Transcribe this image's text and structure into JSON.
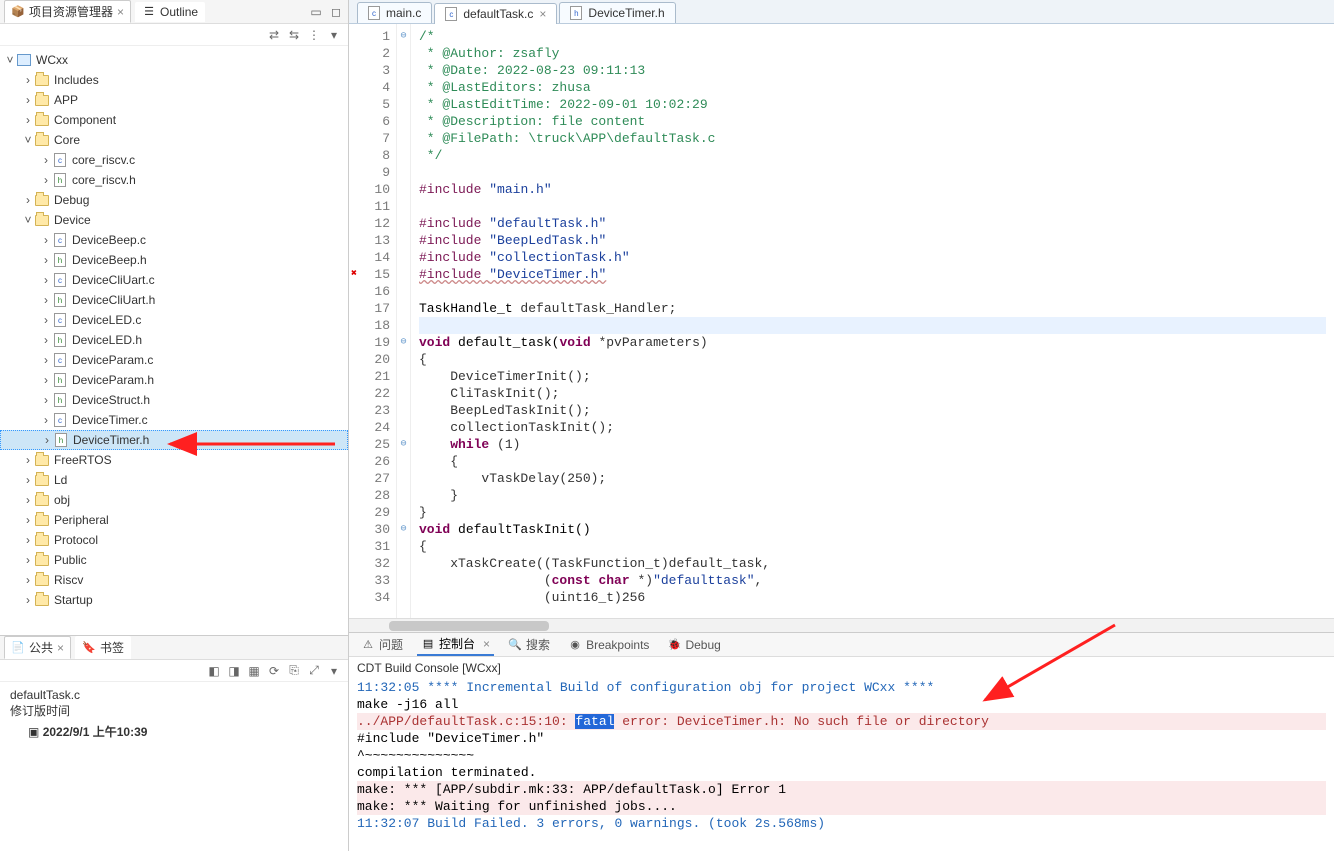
{
  "explorer": {
    "tab_label": "项目资源管理器",
    "outline_tab": "Outline",
    "project": "WCxx",
    "nodes": [
      {
        "depth": 1,
        "caret": ">",
        "icon": "folder",
        "label": "Includes"
      },
      {
        "depth": 1,
        "caret": ">",
        "icon": "folder",
        "label": "APP"
      },
      {
        "depth": 1,
        "caret": ">",
        "icon": "folder",
        "label": "Component"
      },
      {
        "depth": 1,
        "caret": "v",
        "icon": "folder",
        "label": "Core"
      },
      {
        "depth": 2,
        "caret": ">",
        "icon": "c",
        "label": "core_riscv.c"
      },
      {
        "depth": 2,
        "caret": ">",
        "icon": "h",
        "label": "core_riscv.h"
      },
      {
        "depth": 1,
        "caret": ">",
        "icon": "folder",
        "label": "Debug"
      },
      {
        "depth": 1,
        "caret": "v",
        "icon": "folder",
        "label": "Device"
      },
      {
        "depth": 2,
        "caret": ">",
        "icon": "c",
        "label": "DeviceBeep.c"
      },
      {
        "depth": 2,
        "caret": ">",
        "icon": "h",
        "label": "DeviceBeep.h"
      },
      {
        "depth": 2,
        "caret": ">",
        "icon": "c",
        "label": "DeviceCliUart.c"
      },
      {
        "depth": 2,
        "caret": ">",
        "icon": "h",
        "label": "DeviceCliUart.h"
      },
      {
        "depth": 2,
        "caret": ">",
        "icon": "c",
        "label": "DeviceLED.c"
      },
      {
        "depth": 2,
        "caret": ">",
        "icon": "h",
        "label": "DeviceLED.h"
      },
      {
        "depth": 2,
        "caret": ">",
        "icon": "c",
        "label": "DeviceParam.c"
      },
      {
        "depth": 2,
        "caret": ">",
        "icon": "h",
        "label": "DeviceParam.h"
      },
      {
        "depth": 2,
        "caret": ">",
        "icon": "h",
        "label": "DeviceStruct.h"
      },
      {
        "depth": 2,
        "caret": ">",
        "icon": "c",
        "label": "DeviceTimer.c"
      },
      {
        "depth": 2,
        "caret": ">",
        "icon": "h",
        "label": "DeviceTimer.h",
        "selected": true
      },
      {
        "depth": 1,
        "caret": ">",
        "icon": "folder",
        "label": "FreeRTOS"
      },
      {
        "depth": 1,
        "caret": ">",
        "icon": "folder",
        "label": "Ld"
      },
      {
        "depth": 1,
        "caret": ">",
        "icon": "folder",
        "label": "obj"
      },
      {
        "depth": 1,
        "caret": ">",
        "icon": "folder",
        "label": "Peripheral"
      },
      {
        "depth": 1,
        "caret": ">",
        "icon": "folder",
        "label": "Protocol"
      },
      {
        "depth": 1,
        "caret": ">",
        "icon": "folder",
        "label": "Public"
      },
      {
        "depth": 1,
        "caret": ">",
        "icon": "folder",
        "label": "Riscv"
      },
      {
        "depth": 1,
        "caret": ">",
        "icon": "folder",
        "label": "Startup"
      }
    ]
  },
  "props": {
    "tab_public": "公共",
    "tab_bookmarks": "书签",
    "file": "defaultTask.c",
    "mod_label": "修订版时间",
    "mod_value": "2022/9/1 上午10:39"
  },
  "editor": {
    "tabs": [
      {
        "label": "main.c",
        "active": false
      },
      {
        "label": "defaultTask.c",
        "active": true
      },
      {
        "label": "DeviceTimer.h",
        "active": false
      }
    ],
    "code": {
      "l1": "/*",
      "l2": " * @Author: zsafly",
      "l3": " * @Date: 2022-08-23 09:11:13",
      "l4": " * @LastEditors: zhusa",
      "l5": " * @LastEditTime: 2022-09-01 10:02:29",
      "l6": " * @Description: file content",
      "l7": " * @FilePath: \\truck\\APP\\defaultTask.c",
      "l8": " */",
      "l9": "",
      "inc": "#include",
      "s10": "\"main.h\"",
      "s12": "\"defaultTask.h\"",
      "s13": "\"BeepLedTask.h\"",
      "s14": "\"collectionTask.h\"",
      "s15": "\"DeviceTimer.h\"",
      "l17a": "TaskHandle_t ",
      "l17b": "defaultTask_Handler;",
      "kw_void": "void",
      "fn19": " default_task(",
      "kw_void2": "void",
      "l19b": " *pvParameters)",
      "l20": "{",
      "l21": "    DeviceTimerInit();",
      "l22": "    CliTaskInit();",
      "l23": "    BeepLedTaskInit();",
      "l24": "    collectionTaskInit();",
      "kw_while": "while",
      "l25b": " (1)",
      "l26": "    {",
      "l27": "        vTaskDelay(250);",
      "l28": "    }",
      "l29": "}",
      "fn30": " defaultTaskInit()",
      "l31": "{",
      "l32a": "    xTaskCreate((TaskFunction_t)default_task,",
      "kw_const": "const",
      "kw_char": "char",
      "l33a": "                (",
      "l33b": " *)",
      "s33": "\"defaulttask\"",
      "l33c": ",",
      "l34": "                (uint16_t)256"
    }
  },
  "console": {
    "tabs": {
      "problems": "问题",
      "console": "控制台",
      "search": "搜索",
      "breakpoints": "Breakpoints",
      "debug": "Debug"
    },
    "title": "CDT Build Console [WCxx]",
    "lines": {
      "l1": "11:32:05 **** Incremental Build of configuration obj for project WCxx ****",
      "l2": "make -j16 all ",
      "l3a": "../APP/defaultTask.c:15:10: ",
      "l3b": "fatal",
      "l3c": " error: DeviceTimer.h: No such file or directory",
      "l4": " #include \"DeviceTimer.h\"",
      "l5": "          ^~~~~~~~~~~~~~~",
      "l6": "compilation terminated.",
      "l7": "make: *** [APP/subdir.mk:33: APP/defaultTask.o] Error 1",
      "l8": "make: *** Waiting for unfinished jobs....",
      "l9": "",
      "l10": "11:32:07 Build Failed. 3 errors, 0 warnings. (took 2s.568ms)"
    }
  }
}
